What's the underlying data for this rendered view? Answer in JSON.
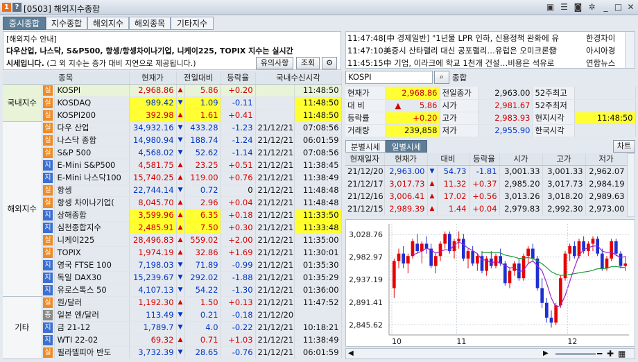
{
  "window": {
    "icon1": "1",
    "icon2": "?",
    "title": "[0503] 해외지수종합",
    "icons": [
      "new-window-icon",
      "list-icon",
      "camera-icon",
      "settings-icon",
      "minimize-icon",
      "maximize-icon",
      "close-icon"
    ]
  },
  "tabs": [
    "증시종합",
    "지수종합",
    "해외지수",
    "해외종목",
    "기타지수"
  ],
  "notice": {
    "title": "[해외지수 안내]",
    "line1": "다우산업, 나스닥, S&P500, 항셍/항셍차이나기업, 니케이225, TOPIX 지수는 실시간",
    "line2_bold": "시세입니다.",
    "line2_rest": " (그 외 지수는 증가 대비 지연으로 제공됩니다.)",
    "btn_notice": "유의사항",
    "btn_query": "조회"
  },
  "table": {
    "headers": [
      "종목",
      "현재가",
      "전일대비",
      "등락율",
      "국내수신시각"
    ],
    "groups": [
      {
        "name": "국내지수",
        "rows": [
          {
            "m": "실",
            "mc": "o",
            "name": "KOSPI",
            "price": "2,968.86",
            "pc": "red",
            "dir": "▲",
            "chg": "5.86",
            "rate": "+0.20",
            "rc": "red",
            "date": "",
            "time": "11:48:50",
            "hl": true,
            "yp": true,
            "yc": true,
            "yt": false
          },
          {
            "m": "실",
            "mc": "o",
            "name": "KOSDAQ",
            "price": "989.42",
            "pc": "blue",
            "dir": "▼",
            "chg": "1.09",
            "rate": "-0.11",
            "rc": "blue",
            "date": "",
            "time": "11:48:50",
            "hl": false,
            "yp": true,
            "yc": true,
            "yt": true
          },
          {
            "m": "실",
            "mc": "o",
            "name": "KOSPI200",
            "price": "392.98",
            "pc": "red",
            "dir": "▲",
            "chg": "1.61",
            "rate": "+0.41",
            "rc": "red",
            "date": "",
            "time": "11:48:50",
            "hl": false,
            "yp": true,
            "yc": true,
            "yt": true
          }
        ]
      },
      {
        "name": "해외지수",
        "rows": [
          {
            "m": "실",
            "mc": "o",
            "name": "다우 산업",
            "price": "34,932.16",
            "pc": "blue",
            "dir": "▼",
            "chg": "433.28",
            "rate": "-1.23",
            "rc": "blue",
            "date": "21/12/21",
            "time": "07:08:56"
          },
          {
            "m": "실",
            "mc": "o",
            "name": "나스닥 종합",
            "price": "14,980.94",
            "pc": "blue",
            "dir": "▼",
            "chg": "188.74",
            "rate": "-1.24",
            "rc": "blue",
            "date": "21/12/21",
            "time": "06:01:59"
          },
          {
            "m": "실",
            "mc": "o",
            "name": "S&P 500",
            "price": "4,568.02",
            "pc": "blue",
            "dir": "▼",
            "chg": "52.62",
            "rate": "-1.14",
            "rc": "blue",
            "date": "21/12/21",
            "time": "07:08:56"
          },
          {
            "m": "지",
            "mc": "b",
            "name": "E-Mini S&P500",
            "price": "4,581.75",
            "pc": "red",
            "dir": "▲",
            "chg": "23.25",
            "rate": "+0.51",
            "rc": "red",
            "date": "21/12/21",
            "time": "11:38:45"
          },
          {
            "m": "지",
            "mc": "b",
            "name": "E-Mini 나스닥100",
            "price": "15,740.25",
            "pc": "red",
            "dir": "▲",
            "chg": "119.00",
            "rate": "+0.76",
            "rc": "red",
            "date": "21/12/21",
            "time": "11:38:49"
          },
          {
            "m": "실",
            "mc": "o",
            "name": "항셍",
            "price": "22,744.14",
            "pc": "blue",
            "dir": "▼",
            "chg": "0.72",
            "rate": "0",
            "rc": "",
            "date": "21/12/21",
            "time": "11:48:48"
          },
          {
            "m": "실",
            "mc": "o",
            "name": "항셍 차이나기업(",
            "price": "8,045.70",
            "pc": "red",
            "dir": "▲",
            "chg": "2.96",
            "rate": "+0.04",
            "rc": "red",
            "date": "21/12/21",
            "time": "11:48:48"
          },
          {
            "m": "지",
            "mc": "b",
            "name": "상해종합",
            "price": "3,599.96",
            "pc": "red",
            "dir": "▲",
            "chg": "6.35",
            "rate": "+0.18",
            "rc": "red",
            "date": "21/12/21",
            "time": "11:33:50",
            "yp": true,
            "yc": true,
            "yt": true
          },
          {
            "m": "지",
            "mc": "b",
            "name": "심천종합지수",
            "price": "2,485.91",
            "pc": "red",
            "dir": "▲",
            "chg": "7.50",
            "rate": "+0.30",
            "rc": "red",
            "date": "21/12/21",
            "time": "11:33:48",
            "yp": true,
            "yc": true,
            "yt": true
          },
          {
            "m": "실",
            "mc": "o",
            "name": "니케이225",
            "price": "28,496.83",
            "pc": "red",
            "dir": "▲",
            "chg": "559.02",
            "rate": "+2.00",
            "rc": "red",
            "date": "21/12/21",
            "time": "11:35:00"
          },
          {
            "m": "실",
            "mc": "o",
            "name": "TOPIX",
            "price": "1,974.19",
            "pc": "red",
            "dir": "▲",
            "chg": "32.86",
            "rate": "+1.69",
            "rc": "red",
            "date": "21/12/21",
            "time": "11:30:01"
          },
          {
            "m": "지",
            "mc": "b",
            "name": "영국 FTSE 100",
            "price": "7,198.03",
            "pc": "blue",
            "dir": "▼",
            "chg": "71.89",
            "rate": "-0.99",
            "rc": "blue",
            "date": "21/12/21",
            "time": "01:35:30"
          },
          {
            "m": "지",
            "mc": "b",
            "name": "독일 DAX30",
            "price": "15,239.67",
            "pc": "blue",
            "dir": "▼",
            "chg": "292.02",
            "rate": "-1.88",
            "rc": "blue",
            "date": "21/12/21",
            "time": "01:35:29"
          },
          {
            "m": "지",
            "mc": "b",
            "name": "유로스톡스 50",
            "price": "4,107.13",
            "pc": "blue",
            "dir": "▼",
            "chg": "54.22",
            "rate": "-1.30",
            "rc": "blue",
            "date": "21/12/21",
            "time": "01:36:00"
          }
        ]
      },
      {
        "name": "기타",
        "rows": [
          {
            "m": "실",
            "mc": "o",
            "name": "원/달러",
            "price": "1,192.30",
            "pc": "red",
            "dir": "▲",
            "chg": "1.50",
            "rate": "+0.13",
            "rc": "red",
            "date": "21/12/21",
            "time": "11:47:52"
          },
          {
            "m": "종",
            "mc": "g",
            "name": "일본 엔/달러",
            "price": "113.49",
            "pc": "blue",
            "dir": "▼",
            "chg": "0.21",
            "rate": "-0.18",
            "rc": "blue",
            "date": "21/12/20",
            "time": ""
          },
          {
            "m": "지",
            "mc": "b",
            "name": "금 21-12",
            "price": "1,789.7",
            "pc": "blue",
            "dir": "▼",
            "chg": "4.0",
            "rate": "-0.22",
            "rc": "blue",
            "date": "21/12/21",
            "time": "10:18:21"
          },
          {
            "m": "지",
            "mc": "b",
            "name": "WTI 22-02",
            "price": "69.32",
            "pc": "red",
            "dir": "▲",
            "chg": "0.71",
            "rate": "+1.03",
            "rc": "red",
            "date": "21/12/21",
            "time": "11:38:49"
          },
          {
            "m": "실",
            "mc": "o",
            "name": "필라델피아 반도",
            "price": "3,732.39",
            "pc": "blue",
            "dir": "▼",
            "chg": "28.65",
            "rate": "-0.76",
            "rc": "blue",
            "date": "21/12/21",
            "time": "06:01:59"
          }
        ]
      }
    ]
  },
  "news": [
    {
      "time": "11:47:48",
      "text": "[中 경제일반] \"1년물 LPR 인하, 신용정책 완화에 유",
      "src": "한경차이"
    },
    {
      "time": "11:47:10",
      "text": "美증시 산타랠리 대신 공포랠리…유럽은 오미크론發",
      "src": "아시아경"
    },
    {
      "time": "11:45:15",
      "text": "中 기업, 이라크에 학교 1천개 건설…비용은 석유로",
      "src": "연합뉴스"
    }
  ],
  "search": {
    "value": "KOSPI",
    "btn": "종합"
  },
  "quote": {
    "r1": {
      "l1": "현재가",
      "v1": "2,968.86",
      "l2": "전일종가",
      "v2": "2,963.00",
      "l3": "52주최고",
      "v3": ""
    },
    "r2": {
      "l1": "대 비",
      "dir": "▲",
      "v1": "5.86",
      "l2": "시가",
      "v2": "2,981.67",
      "l3": "52주최저",
      "v3": ""
    },
    "r3": {
      "l1": "등락률",
      "v1": "+0.20",
      "l2": "고가",
      "v2": "2,983.93",
      "l3": "현지시각",
      "v3": "11:48:50"
    },
    "r4": {
      "l1": "거래량",
      "v1": "239,858",
      "l2": "저가",
      "v2": "2,955.90",
      "l3": "한국시각",
      "v3": ""
    }
  },
  "subtabs": {
    "minute": "분별시세",
    "daily": "일별시세",
    "chart_btn": "차트"
  },
  "daily": {
    "headers": [
      "현재일자",
      "현재가",
      "대비",
      "등락율",
      "시가",
      "고가",
      "저가"
    ],
    "rows": [
      {
        "date": "21/12/20",
        "price": "2,963.00",
        "dir": "▼",
        "dc": "blue",
        "chg": "54.73",
        "rate": "-1.81",
        "open": "3,001.33",
        "high": "3,001.33",
        "low": "2,962.07"
      },
      {
        "date": "21/12/17",
        "price": "3,017.73",
        "dir": "▲",
        "dc": "red",
        "chg": "11.32",
        "rate": "+0.37",
        "open": "2,985.20",
        "high": "3,017.73",
        "low": "2,984.19"
      },
      {
        "date": "21/12/16",
        "price": "3,006.41",
        "dir": "▲",
        "dc": "red",
        "chg": "17.02",
        "rate": "+0.56",
        "open": "3,013.26",
        "high": "3,018.20",
        "low": "2,989.63"
      },
      {
        "date": "21/12/15",
        "price": "2,989.39",
        "dir": "▲",
        "dc": "red",
        "chg": "1.44",
        "rate": "+0.04",
        "open": "2,979.83",
        "high": "2,992.30",
        "low": "2,973.00"
      }
    ]
  },
  "chart_data": {
    "type": "candlestick",
    "y_ticks": [
      "3,028.76",
      "2,982.97",
      "2,937.19",
      "2,891.41",
      "2,845.62"
    ],
    "ylim": [
      2825,
      3050
    ],
    "x_labels": [
      "10",
      "11",
      "12"
    ],
    "up_color": "#e60000",
    "down_color": "#1f2fd0",
    "candles": [
      [
        2920,
        2980,
        2900,
        2975
      ],
      [
        2975,
        3000,
        2960,
        2990
      ],
      [
        2990,
        3005,
        2960,
        2970
      ],
      [
        2970,
        2990,
        2950,
        2985
      ],
      [
        2985,
        3020,
        2980,
        3015
      ],
      [
        3010,
        3030,
        2990,
        2995
      ],
      [
        2995,
        3015,
        2970,
        3010
      ],
      [
        3010,
        3025,
        2990,
        3000
      ],
      [
        3000,
        3010,
        2960,
        2965
      ],
      [
        2965,
        2990,
        2950,
        2985
      ],
      [
        2985,
        3015,
        2975,
        3010
      ],
      [
        3010,
        3035,
        3000,
        3030
      ],
      [
        3030,
        3035,
        2990,
        2995
      ],
      [
        2995,
        3020,
        2980,
        3015
      ],
      [
        3015,
        3035,
        3000,
        3020
      ],
      [
        3020,
        3030,
        2975,
        2980
      ],
      [
        2980,
        3000,
        2960,
        2995
      ],
      [
        2995,
        3005,
        2965,
        2970
      ],
      [
        2970,
        2990,
        2955,
        2985
      ],
      [
        2985,
        2995,
        2950,
        2955
      ],
      [
        2955,
        2985,
        2945,
        2980
      ],
      [
        2980,
        2995,
        2960,
        2965
      ],
      [
        2965,
        2990,
        2960,
        2985
      ],
      [
        2985,
        3000,
        2965,
        2970
      ],
      [
        2970,
        2975,
        2925,
        2930
      ],
      [
        2930,
        2960,
        2920,
        2955
      ],
      [
        2955,
        2975,
        2945,
        2970
      ],
      [
        2970,
        2980,
        2935,
        2940
      ],
      [
        2940,
        2990,
        2935,
        2985
      ],
      [
        2985,
        3005,
        2970,
        3000
      ],
      [
        3000,
        3010,
        2975,
        2980
      ],
      [
        2980,
        2985,
        2915,
        2920
      ],
      [
        2920,
        2940,
        2880,
        2890
      ],
      [
        2890,
        2900,
        2850,
        2860
      ],
      [
        2860,
        2875,
        2840,
        2850
      ],
      [
        2850,
        2890,
        2845,
        2885
      ],
      [
        2885,
        2945,
        2880,
        2940
      ],
      [
        2940,
        2995,
        2935,
        2990
      ],
      [
        2990,
        3010,
        2975,
        3005
      ],
      [
        3005,
        3015,
        2980,
        2985
      ],
      [
        2985,
        3020,
        2980,
        3015
      ],
      [
        3015,
        3025,
        2990,
        2995
      ],
      [
        2995,
        3015,
        2985,
        3010
      ],
      [
        3010,
        3025,
        2995,
        3020
      ],
      [
        3020,
        3025,
        2985,
        2990
      ],
      [
        2990,
        3000,
        2955,
        2960
      ],
      [
        2960,
        2985,
        2955,
        2980
      ],
      [
        2980,
        3020,
        2975,
        3015
      ],
      [
        3015,
        3020,
        2985,
        2990
      ],
      [
        2990,
        2995,
        2960,
        2965
      ],
      [
        2965,
        2985,
        2955,
        2970
      ]
    ]
  }
}
